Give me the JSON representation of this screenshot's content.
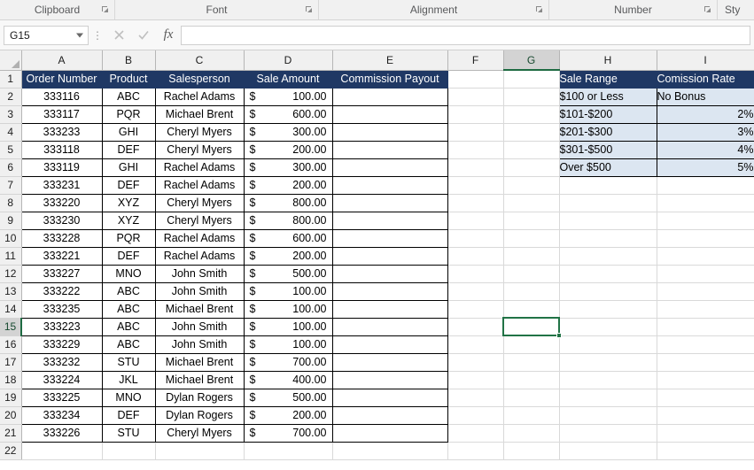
{
  "ribbon": {
    "groups": [
      {
        "label": "Clipboard",
        "launcher": true
      },
      {
        "label": "Font",
        "launcher": true
      },
      {
        "label": "Alignment",
        "launcher": true
      },
      {
        "label": "Number",
        "launcher": true
      },
      {
        "label": "Sty",
        "launcher": false
      }
    ]
  },
  "formula_bar": {
    "name_box_value": "G15",
    "cancel_icon": "close-icon",
    "enter_icon": "check-icon",
    "function_icon": "fx-icon",
    "formula_value": "",
    "formula_placeholder": ""
  },
  "grid": {
    "columns": [
      "A",
      "B",
      "C",
      "D",
      "E",
      "F",
      "G",
      "H",
      "I"
    ],
    "selected_column": "G",
    "selected_row": 15,
    "selected_cell": "G15",
    "rows": [
      1,
      2,
      3,
      4,
      5,
      6,
      7,
      8,
      9,
      10,
      11,
      12,
      13,
      14,
      15,
      16,
      17,
      18,
      19,
      20,
      21,
      22
    ]
  },
  "sales_table": {
    "headers": [
      "Order Number",
      "Product",
      "Salesperson",
      "Sale Amount",
      "Commission Payout"
    ],
    "currency_symbol": "$",
    "rows": [
      {
        "order": "333116",
        "product": "ABC",
        "salesperson": "Rachel Adams",
        "amount": "100.00",
        "commission": ""
      },
      {
        "order": "333117",
        "product": "PQR",
        "salesperson": "Michael Brent",
        "amount": "600.00",
        "commission": ""
      },
      {
        "order": "333233",
        "product": "GHI",
        "salesperson": "Cheryl Myers",
        "amount": "300.00",
        "commission": ""
      },
      {
        "order": "333118",
        "product": "DEF",
        "salesperson": "Cheryl Myers",
        "amount": "200.00",
        "commission": ""
      },
      {
        "order": "333119",
        "product": "GHI",
        "salesperson": "Rachel Adams",
        "amount": "300.00",
        "commission": ""
      },
      {
        "order": "333231",
        "product": "DEF",
        "salesperson": "Rachel Adams",
        "amount": "200.00",
        "commission": ""
      },
      {
        "order": "333220",
        "product": "XYZ",
        "salesperson": "Cheryl Myers",
        "amount": "800.00",
        "commission": ""
      },
      {
        "order": "333230",
        "product": "XYZ",
        "salesperson": "Cheryl Myers",
        "amount": "800.00",
        "commission": ""
      },
      {
        "order": "333228",
        "product": "PQR",
        "salesperson": "Rachel Adams",
        "amount": "600.00",
        "commission": ""
      },
      {
        "order": "333221",
        "product": "DEF",
        "salesperson": "Rachel Adams",
        "amount": "200.00",
        "commission": ""
      },
      {
        "order": "333227",
        "product": "MNO",
        "salesperson": "John Smith",
        "amount": "500.00",
        "commission": ""
      },
      {
        "order": "333222",
        "product": "ABC",
        "salesperson": "John Smith",
        "amount": "100.00",
        "commission": ""
      },
      {
        "order": "333235",
        "product": "ABC",
        "salesperson": "Michael Brent",
        "amount": "100.00",
        "commission": ""
      },
      {
        "order": "333223",
        "product": "ABC",
        "salesperson": "John Smith",
        "amount": "100.00",
        "commission": ""
      },
      {
        "order": "333229",
        "product": "ABC",
        "salesperson": "John Smith",
        "amount": "100.00",
        "commission": ""
      },
      {
        "order": "333232",
        "product": "STU",
        "salesperson": "Michael Brent",
        "amount": "700.00",
        "commission": ""
      },
      {
        "order": "333224",
        "product": "JKL",
        "salesperson": "Michael Brent",
        "amount": "400.00",
        "commission": ""
      },
      {
        "order": "333225",
        "product": "MNO",
        "salesperson": "Dylan Rogers",
        "amount": "500.00",
        "commission": ""
      },
      {
        "order": "333234",
        "product": "DEF",
        "salesperson": "Dylan Rogers",
        "amount": "200.00",
        "commission": ""
      },
      {
        "order": "333226",
        "product": "STU",
        "salesperson": "Cheryl Myers",
        "amount": "700.00",
        "commission": ""
      }
    ]
  },
  "commission_table": {
    "headers": [
      "Sale Range",
      "Comission Rate"
    ],
    "rows": [
      {
        "range": "$100 or Less",
        "rate": "No Bonus",
        "rate_align": "left"
      },
      {
        "range": "$101-$200",
        "rate": "2%",
        "rate_align": "right"
      },
      {
        "range": "$201-$300",
        "rate": "3%",
        "rate_align": "right"
      },
      {
        "range": "$301-$500",
        "rate": "4%",
        "rate_align": "right"
      },
      {
        "range": "Over $500",
        "rate": "5%",
        "rate_align": "right"
      }
    ]
  },
  "colors": {
    "header_navy": "#1F3864",
    "lookup_fill": "#DCE6F1",
    "selection_green": "#217346",
    "grid_line": "#D9D9D9"
  }
}
